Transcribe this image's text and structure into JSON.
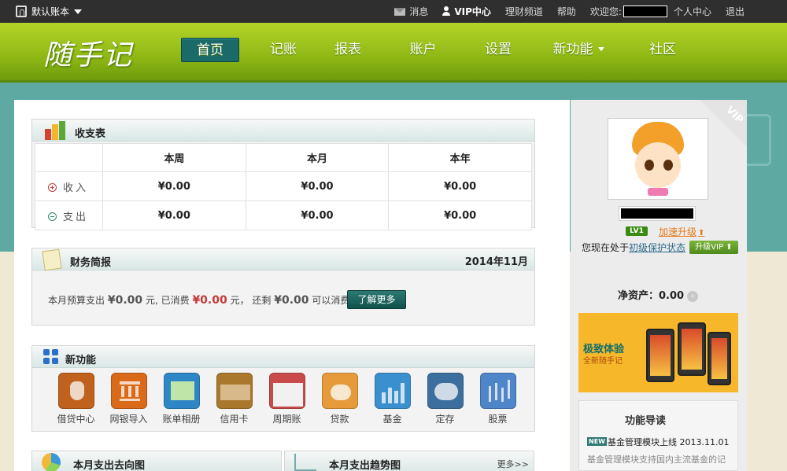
{
  "topbar": {
    "book_label": "默认账本",
    "links": [
      "消息",
      "VIP中心",
      "理财频道",
      "帮助",
      "欢迎您:",
      "个人中心",
      "退出"
    ]
  },
  "header": {
    "logo_text": "随手记",
    "nav": [
      "首页",
      "记账",
      "报表",
      "账户",
      "设置",
      "新功能",
      "社区"
    ],
    "active_nav": "首页"
  },
  "income_table": {
    "title": "收支表",
    "columns": [
      "本周",
      "本月",
      "本年"
    ],
    "rows": [
      {
        "label": "收入",
        "values": [
          "¥0.00",
          "¥0.00",
          "¥0.00"
        ]
      },
      {
        "label": "支出",
        "values": [
          "¥0.00",
          "¥0.00",
          "¥0.00"
        ]
      }
    ]
  },
  "report": {
    "title": "财务简报",
    "date": "2014年11月",
    "t1": "本月预算支出",
    "budget": "¥0.00",
    "t2": "元, 已消费",
    "spent": "¥0.00",
    "t3": "元，  还剩",
    "remain": "¥0.00",
    "t4": "可以消费。",
    "button": "了解更多"
  },
  "features": {
    "title": "新功能",
    "items": [
      {
        "label": "借贷中心",
        "icon": "money-bag-icon",
        "color": "#c0611e"
      },
      {
        "label": "网银导入",
        "icon": "bank-icon",
        "color": "#d96a19"
      },
      {
        "label": "账单相册",
        "icon": "photo-album-icon",
        "color": "#2f86c6"
      },
      {
        "label": "信用卡",
        "icon": "credit-card-icon",
        "color": "#a9782c"
      },
      {
        "label": "周期账",
        "icon": "calendar-icon",
        "color": "#c94a4a"
      },
      {
        "label": "贷款",
        "icon": "loan-icon",
        "color": "#e79a3a"
      },
      {
        "label": "基金",
        "icon": "fund-chart-icon",
        "color": "#3a8fcf"
      },
      {
        "label": "定存",
        "icon": "piggy-bank-icon",
        "color": "#3d6f9e"
      },
      {
        "label": "股票",
        "icon": "stock-chart-icon",
        "color": "#4f86c9"
      }
    ]
  },
  "bottom": {
    "left_title": "本月支出去向图",
    "right_title": "本月支出趋势图",
    "more": "更多>>"
  },
  "sidebar": {
    "vip_ribbon": "VIP",
    "level": "LV1",
    "upgrade": "加速升级",
    "status_prefix": "您现在处于",
    "status_link": "初级保护状态",
    "vip_button": "升级VIP",
    "networth_label": "净资产：",
    "networth_value": "0.00",
    "promo_title": "极致体验",
    "promo_sub": "全新随手记",
    "news_title": "功能导读",
    "news_badge": "NEW",
    "news_item": "基金管理模块上线",
    "news_date": "2013.11.01",
    "news_desc": "基金管理模块支持国内主流基金的记"
  }
}
